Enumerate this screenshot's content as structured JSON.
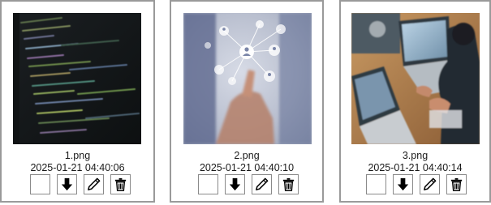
{
  "files": [
    {
      "name": "1.png",
      "timestamp": "2025-01-21 04:40:06",
      "thumbnail": "code-screen-image"
    },
    {
      "name": "2.png",
      "timestamp": "2025-01-21 04:40:10",
      "thumbnail": "network-touch-image"
    },
    {
      "name": "3.png",
      "timestamp": "2025-01-21 04:40:14",
      "thumbnail": "laptop-work-image"
    }
  ],
  "actions": {
    "select": "checkbox",
    "download": "download-arrow-icon",
    "edit": "pencil-icon",
    "delete": "trash-icon"
  }
}
